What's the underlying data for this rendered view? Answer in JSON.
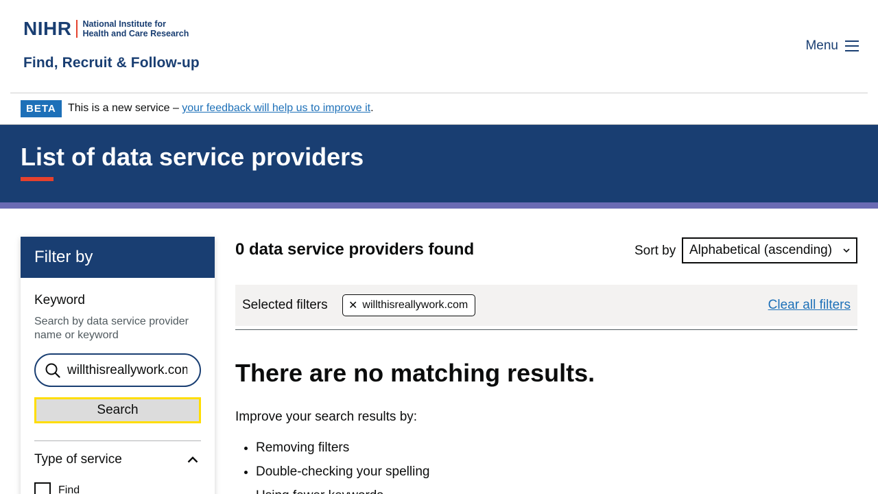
{
  "header": {
    "logo_mark": "NIHR",
    "logo_line1": "National Institute for",
    "logo_line2": "Health and Care Research",
    "service_name": "Find, Recruit & Follow-up",
    "menu_label": "Menu"
  },
  "beta": {
    "tag": "BETA",
    "text": "This is a new service – ",
    "link": "your feedback will help us to improve it",
    "suffix": "."
  },
  "banner": {
    "title": "List of data service providers"
  },
  "filter": {
    "heading": "Filter by",
    "keyword_label": "Keyword",
    "keyword_hint": "Search by data service provider name or keyword",
    "keyword_value": "willthisreallywork.com",
    "search_button": "Search",
    "type_of_service_label": "Type of service",
    "options": [
      "Find"
    ]
  },
  "results": {
    "count_heading": "0 data service providers found",
    "sort_label": "Sort by",
    "sort_selected": "Alphabetical (ascending)",
    "selected_filters_label": "Selected filters",
    "chip_label": "willthisreallywork.com",
    "clear_all": "Clear all filters",
    "no_match_heading": "There are no matching results.",
    "improve_text": "Improve your search results by:",
    "tips": [
      "Removing filters",
      "Double-checking your spelling",
      "Using fewer keywords"
    ]
  },
  "colors": {
    "brand_navy": "#193e72",
    "accent_red": "#e5412d",
    "link_blue": "#1d70b8",
    "focus_yellow": "#ffdd00",
    "strip_purple": "#6a6bb4"
  }
}
